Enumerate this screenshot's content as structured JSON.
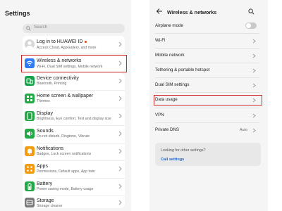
{
  "left": {
    "title": "Settings",
    "search_placeholder": "Search",
    "account": {
      "title": "Log in to HUAWEI ID",
      "subtitle": "Access Cloud, AppGallery, and more",
      "dot_color": "#e3440f"
    },
    "items": [
      {
        "icon": "wireless-icon",
        "color": "#2f7bf5",
        "title": "Wireless & networks",
        "subtitle": "Wi-Fi, Dual SIM settings, Mobile network",
        "highlighted": true
      },
      {
        "icon": "device-connectivity-icon",
        "color": "#16a34a",
        "title": "Device connectivity",
        "subtitle": "Bluetooth, Printing"
      },
      {
        "icon": "home-screen-icon",
        "color": "#22a845",
        "title": "Home screen & wallpaper",
        "subtitle": "Themes"
      },
      {
        "icon": "display-icon",
        "color": "#22a845",
        "title": "Display",
        "subtitle": "Brightness, Eye comfort, Text and display size"
      },
      {
        "icon": "sound-icon",
        "color": "#22a845",
        "title": "Sounds",
        "subtitle": "Do not disturb, Ringtone, Vibrate"
      },
      {
        "icon": "notifications-icon",
        "color": "#f29b0f",
        "title": "Notifications",
        "subtitle": "Badges, Lock screen notifications"
      },
      {
        "icon": "apps-icon",
        "color": "#f29b0f",
        "title": "Apps",
        "subtitle": "Permissions, Default apps, App twin"
      },
      {
        "icon": "battery-icon",
        "color": "#22a845",
        "title": "Battery",
        "subtitle": "Power saving mode, Battery usage"
      },
      {
        "icon": "storage-icon",
        "color": "#7a7a7a",
        "title": "Storage",
        "subtitle": "Storage cleaner"
      }
    ]
  },
  "right": {
    "title": "Wireless & networks",
    "items": [
      {
        "label": "Airplane mode",
        "type": "toggle",
        "on": false
      },
      {
        "label": "Wi-Fi",
        "type": "nav"
      },
      {
        "label": "Mobile network",
        "type": "nav"
      },
      {
        "label": "Tethering & portable hotspot",
        "type": "nav"
      },
      {
        "label": "Dual SIM settings",
        "type": "nav"
      },
      {
        "label": "Data usage",
        "type": "nav",
        "highlighted": true
      },
      {
        "label": "VPN",
        "type": "nav"
      },
      {
        "label": "Private DNS",
        "type": "nav",
        "value": "Auto"
      }
    ],
    "suggestion": {
      "text": "Looking for other settings?",
      "link": "Call settings"
    }
  },
  "colors": {
    "highlight": "#d12a2a",
    "link": "#1f64c8"
  }
}
